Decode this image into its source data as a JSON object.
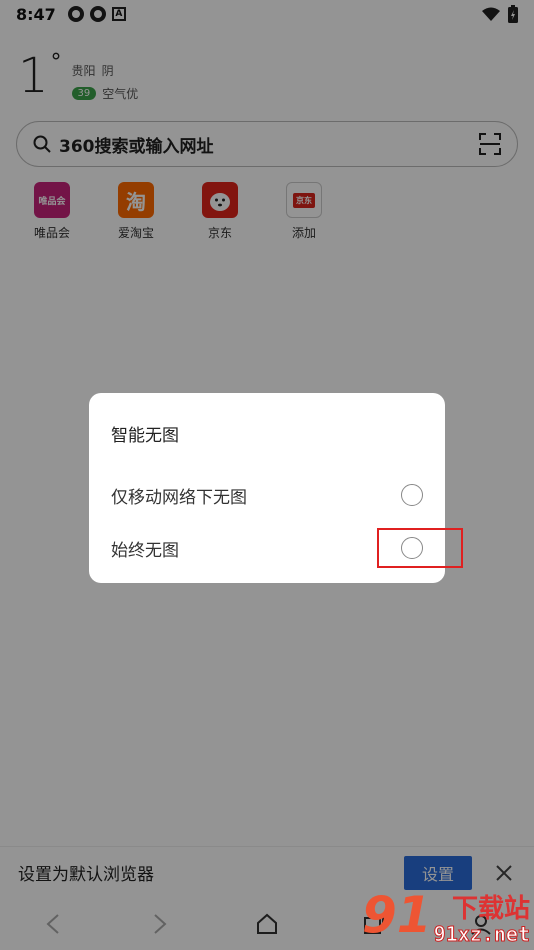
{
  "statusbar": {
    "time": "8:47",
    "notif_letter": "A"
  },
  "weather": {
    "temp": "1",
    "degree": "°",
    "city": "贵阳",
    "condition": "阴",
    "aqi": "39",
    "aqi_text": "空气优"
  },
  "search": {
    "placeholder": "360搜索或输入网址"
  },
  "shortcuts": [
    {
      "label": "唯品会",
      "tile_text": "唯品会",
      "color": "#c6237a"
    },
    {
      "label": "爱淘宝",
      "tile_text": "淘",
      "color": "#ff6a00"
    },
    {
      "label": "京东",
      "tile_text": "",
      "color": "#e1251b"
    },
    {
      "label": "添加",
      "tile_text": "京东",
      "color": "#d9251d"
    }
  ],
  "dialog": {
    "title": "智能无图",
    "options": [
      {
        "label": "仅移动网络下无图",
        "selected": false
      },
      {
        "label": "始终无图",
        "selected": false
      }
    ]
  },
  "banner": {
    "text": "设置为默认浏览器",
    "button": "设置"
  },
  "watermark": {
    "top": "下载站",
    "bottom": "91xz.net",
    "logo": "91"
  },
  "colors": {
    "accent": "#2a6bd9",
    "highlight": "#e02020",
    "overlay": "rgba(0,0,0,0.42)"
  }
}
